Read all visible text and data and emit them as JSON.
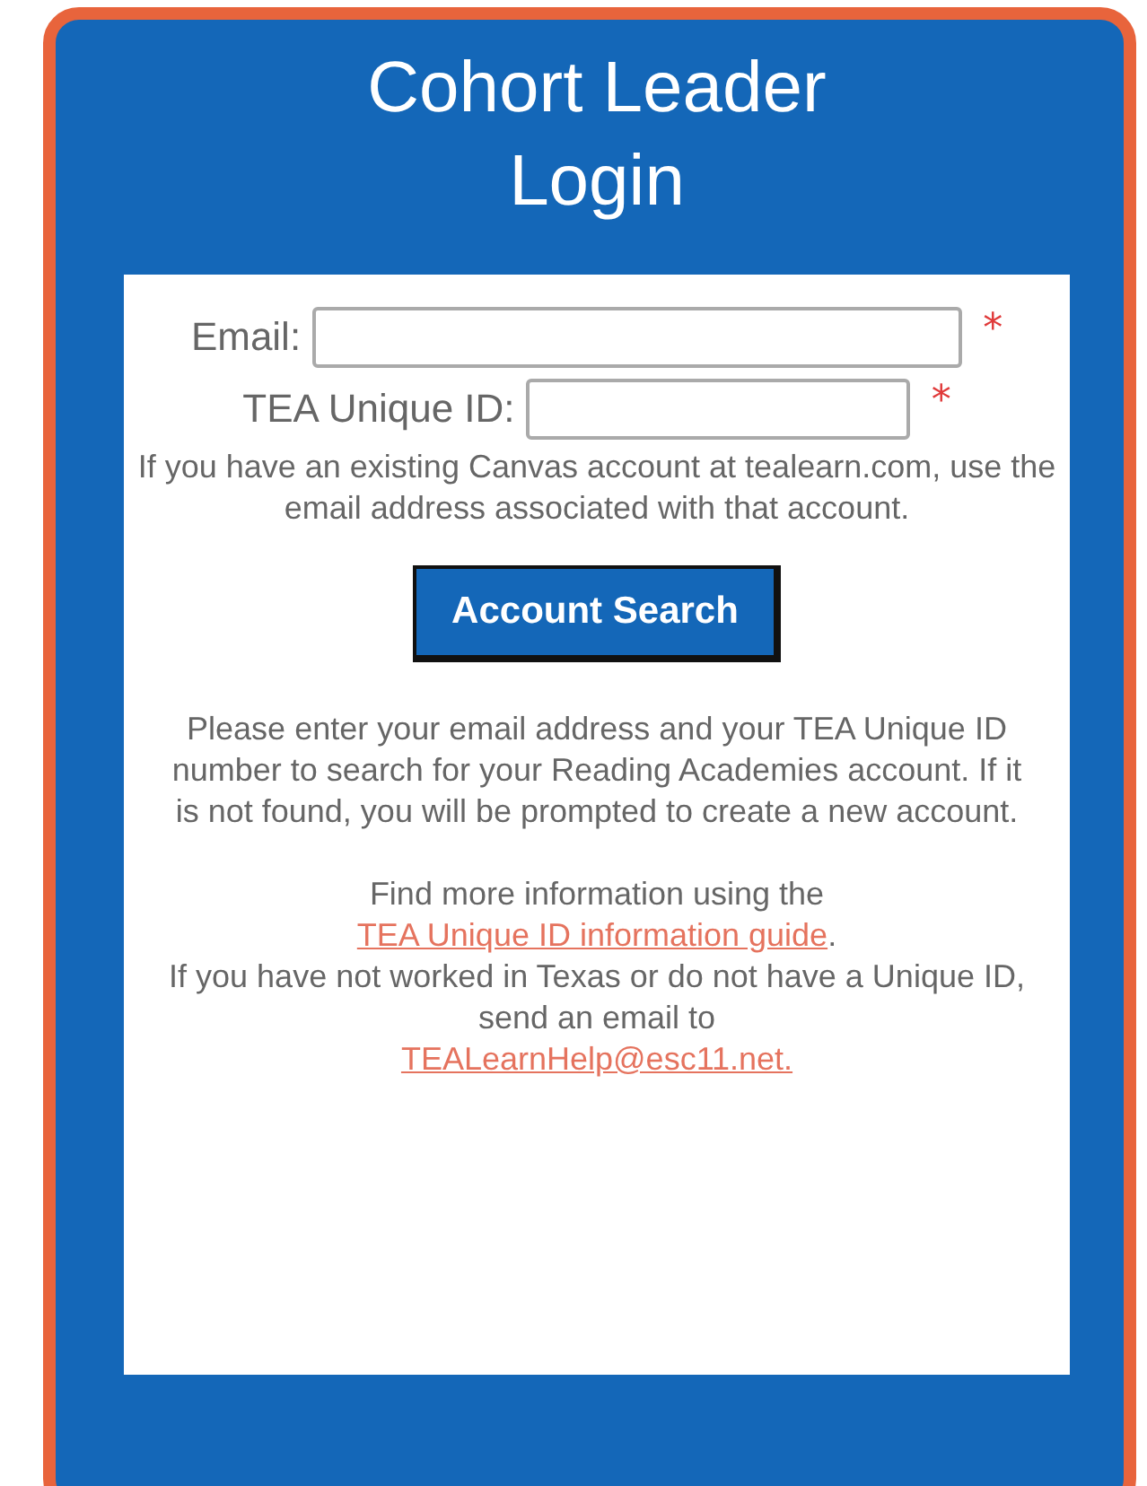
{
  "title": "Cohort Leader Login",
  "fields": [
    {
      "label": "Email:",
      "required_mark": "*"
    },
    {
      "label": "TEA Unique ID:",
      "required_mark": "*"
    }
  ],
  "account_hint": "If you have an existing Canvas account at tealearn.com, use the email address associated with that account.",
  "search_button": "Account Search",
  "search_note": "Please enter your email address and your TEA Unique ID number to search for your Reading Academies account. If it is not found, you will be prompted to create a new account.",
  "info_lines": [
    {
      "before": "Find more information using the",
      "link": "TEA Unique ID information guide",
      "after": "."
    },
    {
      "before": "If you have not worked in Texas or do not have a Unique ID, send an email to",
      "link": "TEALearnHelp@esc11.net."
    }
  ]
}
